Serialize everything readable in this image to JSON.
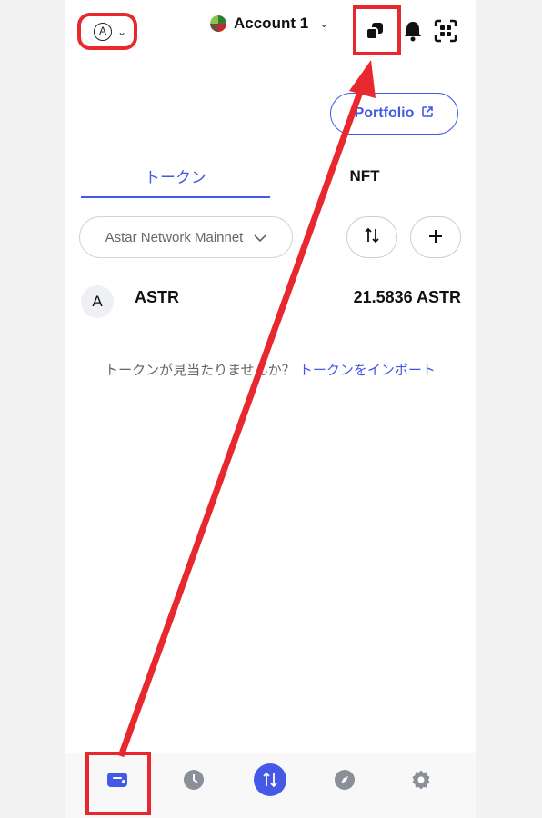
{
  "header": {
    "network_letter": "A",
    "account_name": "Account 1",
    "icons": [
      "copy-icon",
      "bell-icon",
      "scan-icon"
    ]
  },
  "portfolio_button": {
    "label": "Portfolio",
    "icon": "external-link-icon"
  },
  "tabs": [
    {
      "label": "トークン",
      "active": true
    },
    {
      "label": "NFT",
      "active": false
    }
  ],
  "network_select": {
    "value": "Astar Network Mainnet"
  },
  "tokens": [
    {
      "icon_letter": "A",
      "symbol": "ASTR",
      "balance": "21.5836 ASTR"
    }
  ],
  "import": {
    "prompt": "トークンが見当たりませんか？",
    "link": "トークンをインポート"
  },
  "bottom_nav": {
    "items": [
      "wallet-icon",
      "history-icon",
      "swap-icon",
      "explore-icon",
      "settings-icon"
    ],
    "active": "wallet-icon"
  },
  "colors": {
    "accent": "#4459e6",
    "annotation": "#e8282f"
  }
}
